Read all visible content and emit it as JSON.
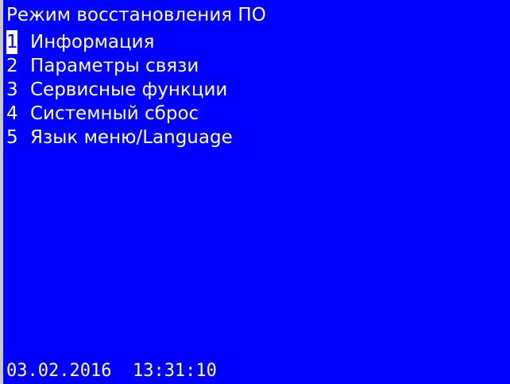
{
  "screen": {
    "title": "Режим восстановления ПО",
    "background_color": "#0000ff",
    "text_color": "#ffffff",
    "selected_index": 0
  },
  "menu": {
    "items": [
      {
        "num": "1",
        "label": "Информация"
      },
      {
        "num": "2",
        "label": "Параметры связи"
      },
      {
        "num": "3",
        "label": "Сервисные функции"
      },
      {
        "num": "4",
        "label": "Системный сброс"
      },
      {
        "num": "5",
        "label": "Язык меню/Language"
      }
    ]
  },
  "status": {
    "date": "03.02.2016",
    "time": "13:31:10"
  }
}
